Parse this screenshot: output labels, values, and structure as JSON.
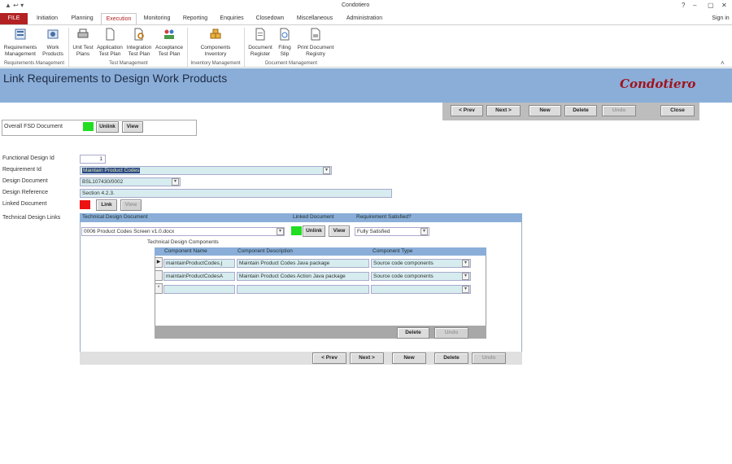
{
  "window": {
    "title": "Condotiero",
    "help": "?",
    "sign_in": "Sign in"
  },
  "tabs": [
    "FILE",
    "Initiation",
    "Planning",
    "Execution",
    "Monitoring",
    "Reporting",
    "Enquiries",
    "Closedown",
    "Miscellaneous",
    "Administration"
  ],
  "ribbon": {
    "buttons": [
      {
        "label1": "Requirements",
        "label2": "Management"
      },
      {
        "label1": "Work",
        "label2": "Products"
      },
      {
        "label1": "Unit Test",
        "label2": "Plans"
      },
      {
        "label1": "Application",
        "label2": "Test Plan"
      },
      {
        "label1": "Integration",
        "label2": "Test Plan"
      },
      {
        "label1": "Acceptance",
        "label2": "Test Plan"
      },
      {
        "label1": "Components",
        "label2": "Inventory"
      },
      {
        "label1": "Document",
        "label2": "Register"
      },
      {
        "label1": "Filing",
        "label2": "Slip"
      },
      {
        "label1": "Print Document",
        "label2": "Registry"
      }
    ],
    "groups": [
      "Requirements Management",
      "Test Management",
      "Inventory Management",
      "Document Management"
    ]
  },
  "header": {
    "title": "Link Requirements to Design Work Products",
    "logo": "Condotiero"
  },
  "nav": {
    "prev": "< Prev",
    "next": "Next >",
    "new": "New",
    "delete": "Delete",
    "undo": "Undo",
    "close": "Close"
  },
  "fsd": {
    "label": "Overall FSD Document",
    "unlink": "Unlink",
    "view": "View"
  },
  "form": {
    "functional_design_id_label": "Functional Design Id",
    "functional_design_id": "1",
    "requirement_id_label": "Requirement Id",
    "requirement_id": "Maintain Product Codes",
    "design_document_label": "Design Document",
    "design_document": "BSL107430/0002",
    "design_reference_label": "Design Reference",
    "design_reference": "Section 4.2.3.",
    "linked_document_label": "Linked Document",
    "link": "Link",
    "view": "View",
    "technical_design_links_label": "Technical Design Links"
  },
  "tech_design": {
    "col_doc": "Technical Design Document",
    "col_linked": "Linked Document",
    "col_satisfied": "Requirement Satisfied?",
    "doc": "0006 Product Codes Screen v1.0.docx",
    "unlink": "Unlink",
    "view": "View",
    "satisfied": "Fully Satisfied",
    "components_label": "Technical Design Components",
    "footer": {
      "prev": "< Prev",
      "next": "Next >",
      "new": "New",
      "delete": "Delete",
      "undo": "Undo"
    }
  },
  "components": {
    "headers": [
      "Component Name",
      "Component Description",
      "Component Type"
    ],
    "rows": [
      {
        "name": "maintainProductCodes.j",
        "desc": "Maintain Product Codes Java package",
        "type": "Source code components"
      },
      {
        "name": "maintainProductCodesA",
        "desc": "Maintain Product Codes Action Java package",
        "type": "Source code components"
      }
    ],
    "delete": "Delete",
    "undo": "Undo"
  },
  "colors": {
    "accent": "#b32222",
    "header": "#8aaed8",
    "field": "#d6ecef",
    "green": "#22dd22",
    "red": "#ee1111"
  }
}
